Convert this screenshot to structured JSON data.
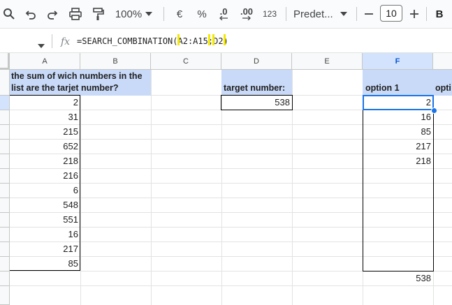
{
  "toolbar": {
    "zoom": "100%",
    "currency": "€",
    "percent": "%",
    "decrease_decimals": ".0",
    "increase_decimals": ".00",
    "number_format": "123",
    "font_name": "Predet...",
    "font_size": "10",
    "bold": "B"
  },
  "formula_bar": {
    "fx": "fx",
    "formula_start": "=SEARCH_COMBINATION(",
    "arg1": "A2:A15",
    "separator": ";",
    "arg2": "D2",
    "formula_end": ")"
  },
  "columns": [
    "A",
    "B",
    "C",
    "D",
    "E",
    "F"
  ],
  "header_cells": {
    "a1": "the sum of wich numbers in the list are the tarjet number?",
    "d1": "target number:",
    "f1": "option 1",
    "g1": "opti"
  },
  "column_a_values": [
    "2",
    "31",
    "215",
    "652",
    "218",
    "216",
    "6",
    "548",
    "551",
    "16",
    "217",
    "85"
  ],
  "d2_value": "538",
  "column_f_values": [
    "2",
    "16",
    "85",
    "217",
    "218"
  ],
  "f_total": "538",
  "colors": {
    "header_fill": "#c9daf8",
    "selection": "#1a73e8",
    "highlight": "#f3e800"
  }
}
